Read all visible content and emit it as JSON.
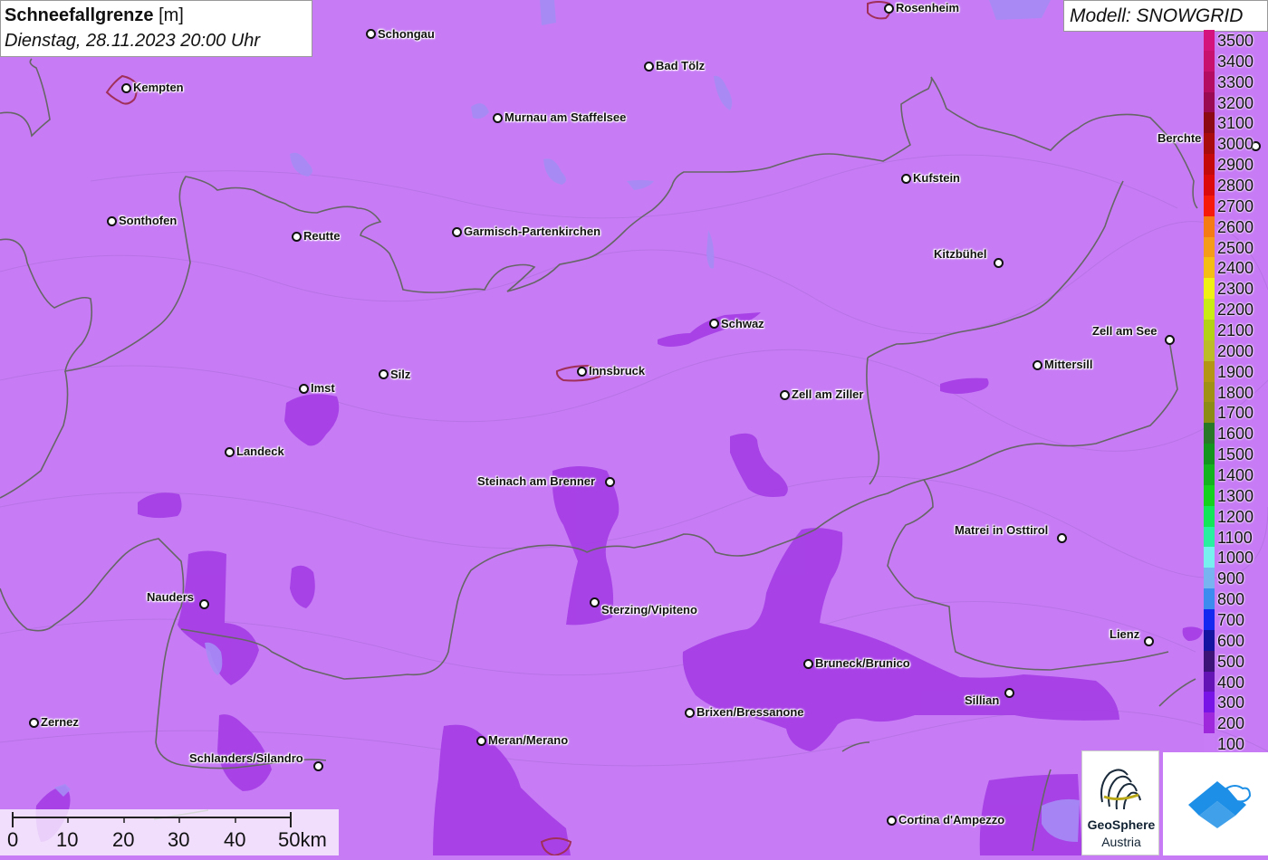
{
  "title": {
    "main": "Schneefallgrenze",
    "unit": "[m]",
    "datetime": "Dienstag, 28.11.2023 20:00 Uhr"
  },
  "model": "Modell: SNOWGRID",
  "legend": {
    "items": [
      {
        "label": "3500",
        "color": "#d4147c"
      },
      {
        "label": "3400",
        "color": "#c8106e"
      },
      {
        "label": "3300",
        "color": "#b40c60"
      },
      {
        "label": "3200",
        "color": "#9a0a52"
      },
      {
        "label": "3100",
        "color": "#8c0a14"
      },
      {
        "label": "3000",
        "color": "#a80c0c"
      },
      {
        "label": "2900",
        "color": "#c40a0a"
      },
      {
        "label": "2800",
        "color": "#dc0a0a"
      },
      {
        "label": "2700",
        "color": "#f51a0a"
      },
      {
        "label": "2600",
        "color": "#f57c14"
      },
      {
        "label": "2500",
        "color": "#f59c1a"
      },
      {
        "label": "2400",
        "color": "#f5be14"
      },
      {
        "label": "2300",
        "color": "#f0f014"
      },
      {
        "label": "2200",
        "color": "#c8ec14"
      },
      {
        "label": "2100",
        "color": "#b4d214"
      },
      {
        "label": "2000",
        "color": "#bcbc28"
      },
      {
        "label": "1900",
        "color": "#b49614"
      },
      {
        "label": "1800",
        "color": "#a09014"
      },
      {
        "label": "1700",
        "color": "#8c8c14"
      },
      {
        "label": "1600",
        "color": "#287828"
      },
      {
        "label": "1500",
        "color": "#14961e"
      },
      {
        "label": "1400",
        "color": "#14b41e"
      },
      {
        "label": "1300",
        "color": "#14d21e"
      },
      {
        "label": "1200",
        "color": "#14e65a"
      },
      {
        "label": "1100",
        "color": "#28f0a0"
      },
      {
        "label": "1000",
        "color": "#78f0f0"
      },
      {
        "label": "900",
        "color": "#78b4f0"
      },
      {
        "label": "800",
        "color": "#3c8cf0"
      },
      {
        "label": "700",
        "color": "#1428f0"
      },
      {
        "label": "600",
        "color": "#1414a0"
      },
      {
        "label": "500",
        "color": "#3c1478"
      },
      {
        "label": "400",
        "color": "#6414b4"
      },
      {
        "label": "300",
        "color": "#7814e6"
      },
      {
        "label": "200",
        "color": "#a028dc"
      },
      {
        "label": "100",
        "color": "#c87cf5"
      }
    ]
  },
  "cities": [
    {
      "id": "rosenheim",
      "name": "Rosenheim"
    },
    {
      "id": "schongau",
      "name": "Schongau"
    },
    {
      "id": "bad-toelz",
      "name": "Bad Tölz"
    },
    {
      "id": "kempten",
      "name": "Kempten"
    },
    {
      "id": "murnau",
      "name": "Murnau am Staffelsee"
    },
    {
      "id": "berchtesgaden",
      "name": "Berchte"
    },
    {
      "id": "kufstein",
      "name": "Kufstein"
    },
    {
      "id": "sonthofen",
      "name": "Sonthofen"
    },
    {
      "id": "reutte",
      "name": "Reutte"
    },
    {
      "id": "garmisch",
      "name": "Garmisch-Partenkirchen"
    },
    {
      "id": "kitzbuehel",
      "name": "Kitzbühel"
    },
    {
      "id": "schwaz",
      "name": "Schwaz"
    },
    {
      "id": "zell-am-see",
      "name": "Zell am See"
    },
    {
      "id": "mittersill",
      "name": "Mittersill"
    },
    {
      "id": "innsbruck",
      "name": "Innsbruck"
    },
    {
      "id": "silz",
      "name": "Silz"
    },
    {
      "id": "imst",
      "name": "Imst"
    },
    {
      "id": "zell-am-ziller",
      "name": "Zell am Ziller"
    },
    {
      "id": "landeck",
      "name": "Landeck"
    },
    {
      "id": "steinach",
      "name": "Steinach am Brenner"
    },
    {
      "id": "matrei",
      "name": "Matrei in Osttirol"
    },
    {
      "id": "nauders",
      "name": "Nauders"
    },
    {
      "id": "sterzing",
      "name": "Sterzing/Vipiteno"
    },
    {
      "id": "lienz",
      "name": "Lienz"
    },
    {
      "id": "bruneck",
      "name": "Bruneck/Brunico"
    },
    {
      "id": "sillian",
      "name": "Sillian"
    },
    {
      "id": "brixen",
      "name": "Brixen/Bressanone"
    },
    {
      "id": "zernez",
      "name": "Zernez"
    },
    {
      "id": "meran",
      "name": "Meran/Merano"
    },
    {
      "id": "schlanders",
      "name": "Schlanders/Silandro"
    },
    {
      "id": "cortina",
      "name": "Cortina d'Ampezzo"
    }
  ],
  "scale": {
    "ticks": [
      "0",
      "10",
      "20",
      "30",
      "40",
      "50km"
    ]
  },
  "logos": {
    "geosphere_line1": "GeoSphere",
    "geosphere_line2": "Austria"
  }
}
